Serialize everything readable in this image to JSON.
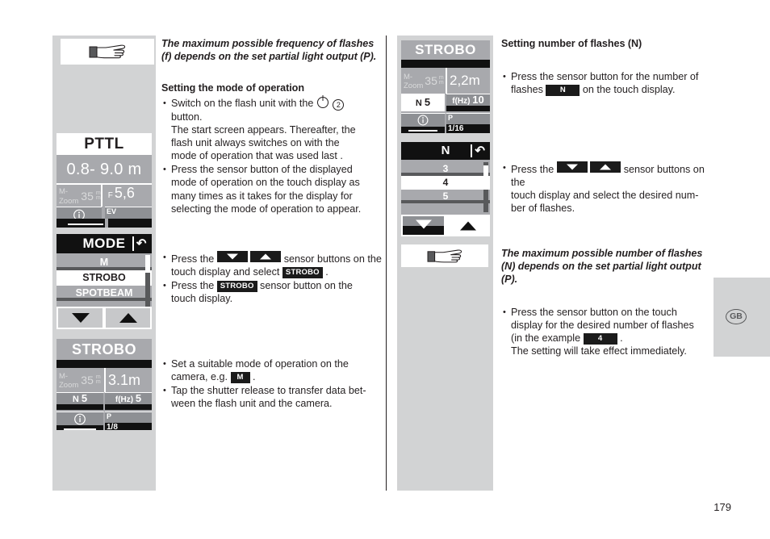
{
  "page": {
    "number": "179",
    "locale_badge": "GB"
  },
  "column_middle": {
    "note_top": "The maximum possible frequency of flashes (f) depends on the set partial light output (P).",
    "heading": "Setting the mode of operation",
    "bullet1_lead": "Switch on the flash unit with the",
    "bullet1_circ": "2",
    "bullet1_rest": "button.",
    "bullet1_sub1": "The start screen appears. Thereafter, the",
    "bullet1_sub2": "flash unit always switches on with the",
    "bullet1_sub3": "mode of operation that was used last .",
    "bullet2_l1": "Press the sensor button of the displayed",
    "bullet2_l2": "mode of operation on the touch display as",
    "bullet2_l3": "many times as it takes for the display for",
    "bullet2_l4": "selecting the mode of operation to appear.",
    "bullet3_pre": "Press the",
    "bullet3_mid": "sensor buttons on the",
    "bullet3_l2a": "touch display and select",
    "bullet3_chip": "STROBO",
    "bullet3_l2b": ".",
    "bullet4_pre": "Press the",
    "bullet4_chip": "STROBO",
    "bullet4_post": "sensor button on the",
    "bullet4_l2": "touch display.",
    "bullet5_l1": "Set a suitable mode of operation on the",
    "bullet5_l2a": "camera, e.g.",
    "bullet5_chip": "M",
    "bullet5_l2b": ".",
    "bullet6_l1": "Tap the shutter release to transfer data bet-",
    "bullet6_l2": "ween the flash unit and the camera."
  },
  "column_right": {
    "heading": "Setting number of flashes (N)",
    "bullet1_l1": "Press the sensor button for the number of",
    "bullet1_l2a": "flashes",
    "bullet1_chip": "N",
    "bullet1_l2b": "on the touch display.",
    "bullet2_pre": "Press the",
    "bullet2_mid": "sensor buttons on the",
    "bullet2_l2": "touch display and select the desired num-",
    "bullet2_l3": "ber of flashes.",
    "note": "The maximum possible number of flashes (N) depends on the set partial light output (P).",
    "bullet3_l1": "Press the sensor button on the touch",
    "bullet3_l2": "display for the desired number of flashes",
    "bullet3_l3a": "(in the example",
    "bullet3_chip": "4",
    "bullet3_l3b": ".",
    "bullet3_l4": "The setting will take effect immediately."
  },
  "lcd_pttl": {
    "mode_title": "PTTL",
    "distance": "0.8- 9.0 m",
    "zoom_label_line1": "M-",
    "zoom_label_line2": "Zoom",
    "zoom_value": "35",
    "zoom_unit": "mm",
    "aperture_prefix": "F",
    "aperture_value": "5,6",
    "info_icon": "info-icon",
    "ev_label": "EV"
  },
  "lcd_mode": {
    "title": "MODE",
    "back_icon": "back-arrow-icon",
    "items": [
      {
        "label": "M",
        "state": "dim"
      },
      {
        "label": "STROBO",
        "state": "selected"
      },
      {
        "label": "SPOTBEAM",
        "state": "dim"
      }
    ],
    "btn_down": "down-arrow-button",
    "btn_up": "up-arrow-button"
  },
  "lcd_strobo_left": {
    "title": "STROBO",
    "zoom_label_line1": "M-",
    "zoom_label_line2": "Zoom",
    "zoom_value": "35",
    "zoom_unit": "mm",
    "distance": "3.1m",
    "n_label": "N",
    "n_value": "5",
    "f_label": "f(Hz)",
    "f_value": "5",
    "info_icon": "info-icon",
    "p_label": "P",
    "p_value": "1/8"
  },
  "lcd_strobo_right": {
    "title": "STROBO",
    "zoom_label_line1": "M-",
    "zoom_label_line2": "Zoom",
    "zoom_value": "35",
    "zoom_unit": "mm",
    "distance": "2,2m",
    "n_label": "N",
    "n_value": "5",
    "f_label": "f(Hz)",
    "f_value": "10",
    "info_icon": "info-icon",
    "p_label": "P",
    "p_value": "1/16"
  },
  "lcd_n_select": {
    "title": "N",
    "back_icon": "back-arrow-icon",
    "items": [
      {
        "label": "3",
        "state": "dim"
      },
      {
        "label": "4",
        "state": "selected"
      },
      {
        "label": "5",
        "state": "dim"
      }
    ],
    "btn_down": "down-arrow-button",
    "btn_up": "up-arrow-button"
  },
  "icons": {
    "hand_pointer": "pointing-hand-icon"
  },
  "colors": {
    "page_bg": "#ffffff",
    "panel_gray": "#d2d3d4",
    "lcd_gray": "#a8a9ad",
    "lcd_dark": "#111111",
    "text": "#231f20"
  }
}
